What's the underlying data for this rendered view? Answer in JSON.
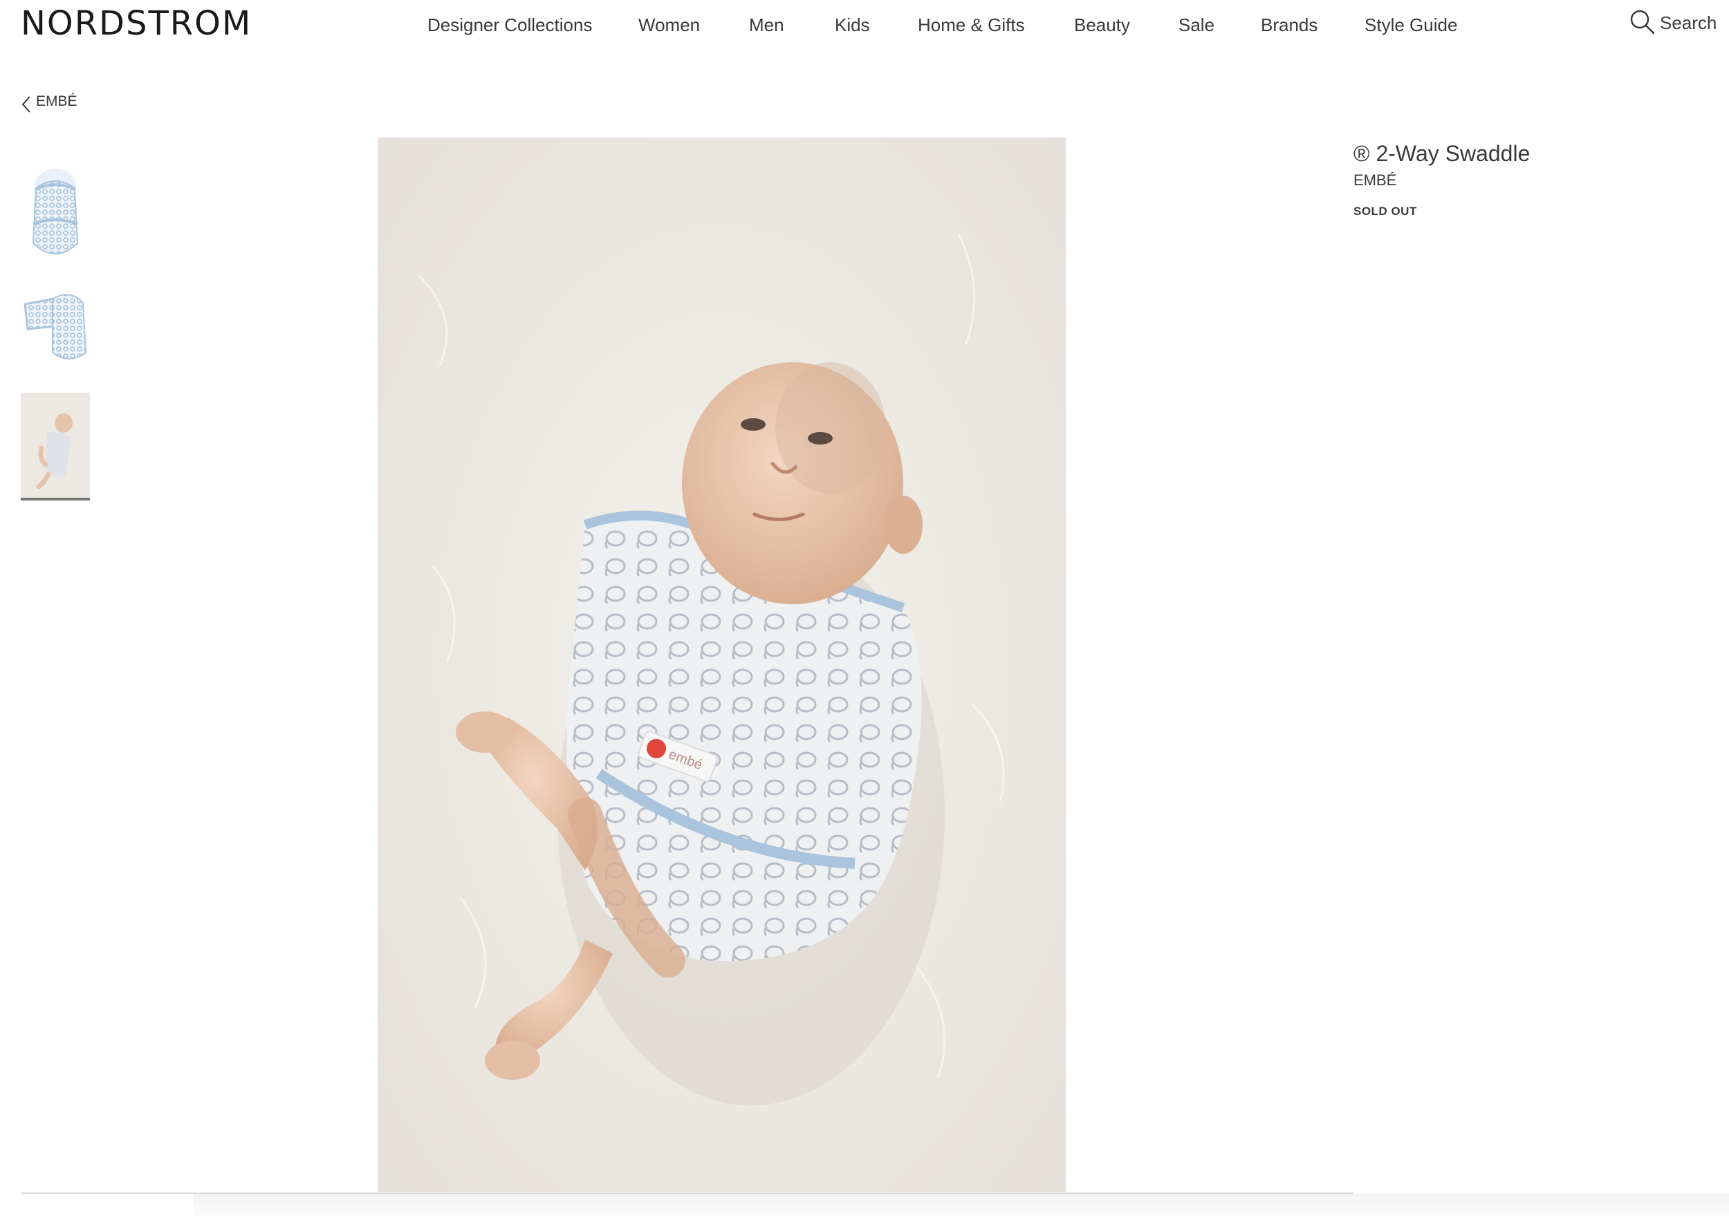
{
  "header": {
    "logo": "NORDSTROM",
    "nav": [
      {
        "label": "Designer Collections"
      },
      {
        "label": "Women"
      },
      {
        "label": "Men"
      },
      {
        "label": "Kids"
      },
      {
        "label": "Home & Gifts"
      },
      {
        "label": "Beauty"
      },
      {
        "label": "Sale"
      },
      {
        "label": "Brands"
      },
      {
        "label": "Style Guide"
      }
    ],
    "search_label": "Search"
  },
  "breadcrumb": {
    "label": "EMBÉ"
  },
  "gallery": {
    "thumbnails": [
      {
        "name": "swaddle-front"
      },
      {
        "name": "swaddle-open"
      },
      {
        "name": "baby-in-swaddle",
        "active": true
      }
    ],
    "main_image_tag": "embé"
  },
  "product": {
    "title": "® 2-Way Swaddle",
    "brand": "EMBÉ",
    "status": "SOLD OUT"
  },
  "colors": {
    "text": "#393939",
    "logo": "#1a1a1a",
    "swaddle_blue": "#a9c4dc",
    "tag_red": "#e0463a"
  },
  "icons": {
    "search": "magnifier-icon",
    "back": "chevron-left-icon"
  }
}
